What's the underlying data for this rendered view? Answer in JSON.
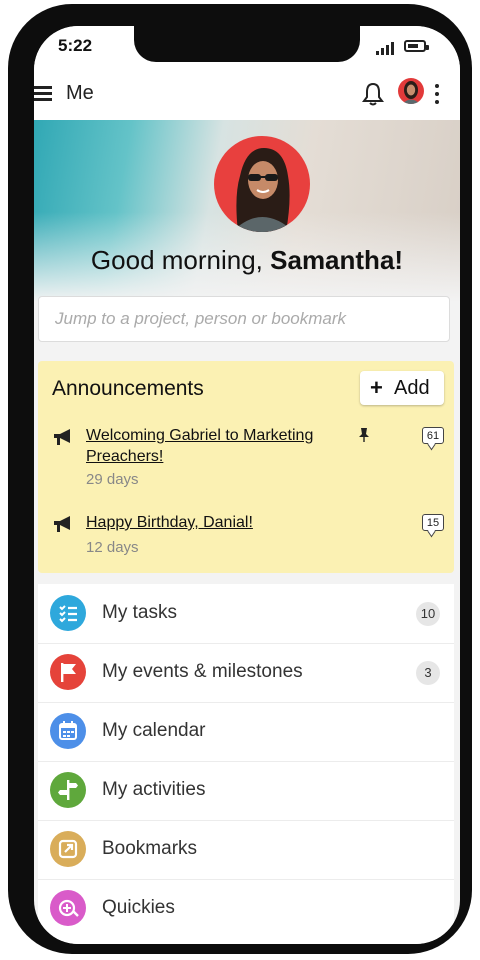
{
  "status_bar": {
    "time": "5:22"
  },
  "app_bar": {
    "title": "Me",
    "icons": [
      "menu-icon",
      "bell-icon",
      "avatar",
      "more-vert-icon"
    ]
  },
  "greeting": {
    "prefix": "Good morning, ",
    "name": "Samantha!"
  },
  "search": {
    "placeholder": "Jump to a project, person or bookmark"
  },
  "announcements": {
    "title": "Announcements",
    "add_label": "Add",
    "items": [
      {
        "title": "Welcoming Gabriel to Marketing Preachers!",
        "age": "29 days",
        "comments": "61",
        "pinned": true
      },
      {
        "title": "Happy Birthday, Danial!",
        "age": "12 days",
        "comments": "15",
        "pinned": false
      }
    ]
  },
  "menu": [
    {
      "label": "My tasks",
      "icon": "tasks-icon",
      "color": "#2ea8dc",
      "count": "10"
    },
    {
      "label": "My events & milestones",
      "icon": "flag-icon",
      "color": "#e5433a",
      "count": "3"
    },
    {
      "label": "My calendar",
      "icon": "calendar-icon",
      "color": "#4d8fe8",
      "count": ""
    },
    {
      "label": "My activities",
      "icon": "activities-icon",
      "color": "#5fa83c",
      "count": ""
    },
    {
      "label": "Bookmarks",
      "icon": "bookmark-icon",
      "color": "#d9ad5a",
      "count": ""
    },
    {
      "label": "Quickies",
      "icon": "quickies-icon",
      "color": "#d95bc9",
      "count": ""
    }
  ]
}
